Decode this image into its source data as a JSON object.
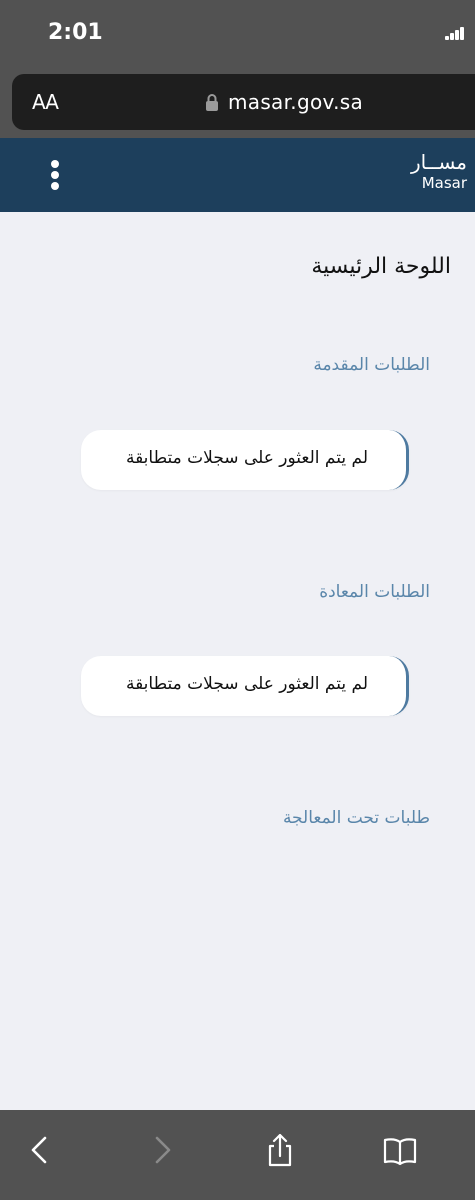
{
  "status_bar": {
    "time": "2:01"
  },
  "browser": {
    "text_size_label": "AA",
    "url": "masar.gov.sa"
  },
  "header": {
    "brand_ar": "مســار",
    "brand_en": "Masar"
  },
  "main": {
    "title": "اللوحة الرئيسية",
    "sections": [
      {
        "title": "الطلبات المقدمة",
        "empty_message": "لم يتم العثور على سجلات متطابقة"
      },
      {
        "title": "الطلبات المعادة",
        "empty_message": "لم يتم العثور على سجلات متطابقة"
      },
      {
        "title": "طلبات تحت المعالجة"
      }
    ]
  },
  "toolbar": {
    "icons": [
      "back-icon",
      "forward-icon",
      "share-icon",
      "bookmarks-icon"
    ]
  },
  "colors": {
    "header_bg": "#1d3f5c",
    "page_bg": "#eff0f5",
    "section_title": "#5a86aa",
    "browser_chrome": "#525252"
  }
}
